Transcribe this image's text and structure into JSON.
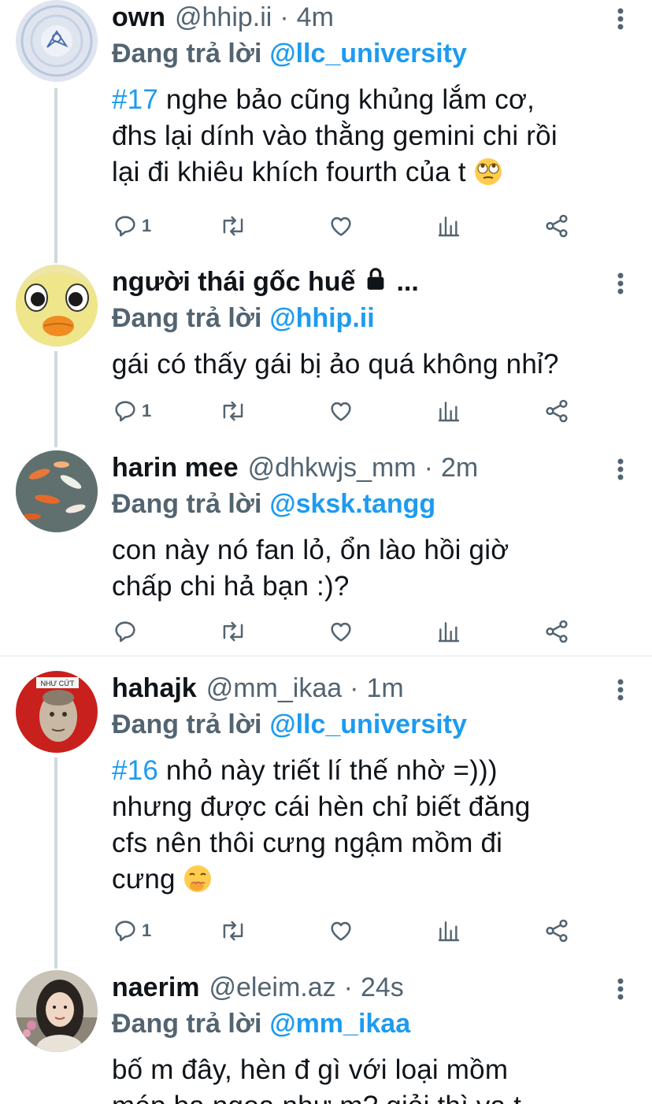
{
  "colors": {
    "accent": "#1d9bf0",
    "muted": "#536471",
    "text": "#0f1419"
  },
  "tweets": [
    {
      "name": "own",
      "handle": "@hhip.ii",
      "sep": "·",
      "time": "4m",
      "replying_label": "Đang trả lời",
      "replying_to": "@llc_university",
      "tag": "#17",
      "text_after_tag": " nghe bảo cũng khủng lắm cơ,",
      "line2": "đhs lại dính vào thằng gemini chi rồi",
      "line3": "lại đi khiêu khích fourth của t",
      "emoji": "face-with-rolling-eyes-icon",
      "reply_count": "1"
    },
    {
      "name": "người thái gốc huế",
      "ellipsis": "...",
      "replying_label": "Đang trả lời",
      "replying_to": "@hhip.ii",
      "text": "gái có thấy gái bị ảo quá không nhỉ?",
      "reply_count": "1"
    },
    {
      "name": "harin mee",
      "handle": "@dhkwjs_mm",
      "sep": "·",
      "time": "2m",
      "replying_label": "Đang trả lời",
      "replying_to": "@sksk.tangg",
      "line1": "con này nó fan lỏ, ổn lào hồi giờ",
      "line2": "chấp chi hả bạn :)?",
      "reply_count": ""
    },
    {
      "name": "hahajk",
      "handle": "@mm_ikaa",
      "sep": "·",
      "time": "1m",
      "replying_label": "Đang trả lời",
      "replying_to": "@llc_university",
      "tag": "#16",
      "text_after_tag": " nhỏ này triết lí thế nhờ =)))",
      "line2": "nhưng được cái hèn chỉ biết đăng",
      "line3": "cfs nên thôi cưng ngậm mồm đi",
      "line4": "cưng",
      "emoji": "face-with-hand-over-mouth-icon",
      "avatar_text": "NHƯ CỨT",
      "reply_count": "1"
    },
    {
      "name": "naerim",
      "handle": "@eleim.az",
      "sep": "·",
      "time": "24s",
      "replying_label": "Đang trả lời",
      "replying_to": "@mm_ikaa",
      "line1": "bố m đây, hèn đ gì với loại mồm",
      "line2": "mép ba ngoa như m? giỏi thì va t"
    }
  ]
}
